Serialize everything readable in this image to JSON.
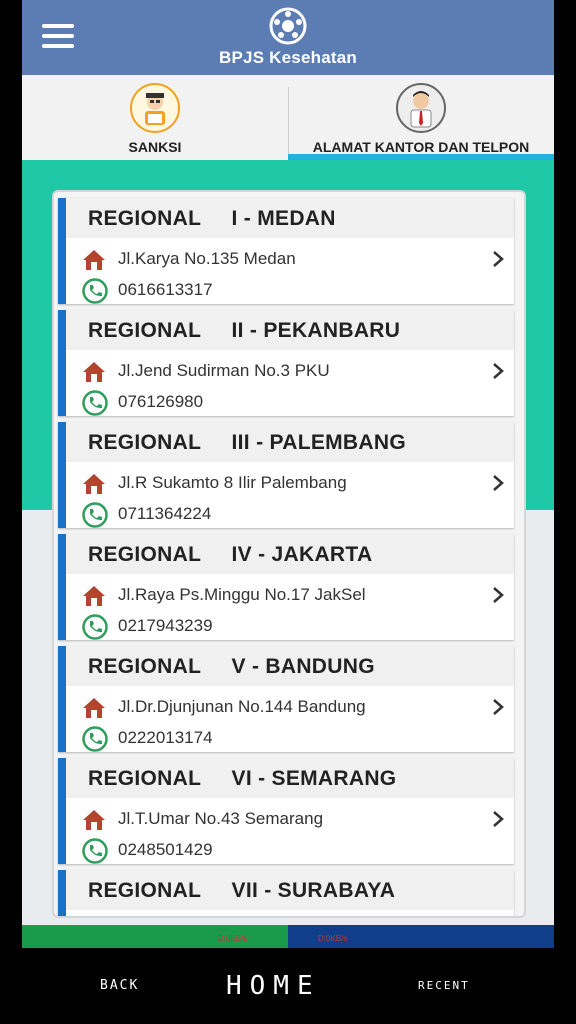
{
  "header": {
    "brand": "BPJS Kesehatan"
  },
  "tabs": [
    {
      "label": "SANKSI"
    },
    {
      "label": "ALAMAT KANTOR DAN TELPON"
    }
  ],
  "status": {
    "speed_left": "D:0KB/s",
    "speed_right": "D:0KB/s"
  },
  "offices": [
    {
      "title": "REGIONAL     I - MEDAN",
      "address": "Jl.Karya No.135 Medan",
      "phone": "0616613317"
    },
    {
      "title": "REGIONAL     II - PEKANBARU",
      "address": "Jl.Jend Sudirman No.3 PKU",
      "phone": "076126980"
    },
    {
      "title": "REGIONAL     III - PALEMBANG",
      "address": "Jl.R Sukamto 8 Ilir Palembang",
      "phone": "0711364224"
    },
    {
      "title": "REGIONAL     IV - JAKARTA",
      "address": "Jl.Raya Ps.Minggu No.17 JakSel",
      "phone": "0217943239"
    },
    {
      "title": "REGIONAL     V - BANDUNG",
      "address": "Jl.Dr.Djunjunan No.144 Bandung",
      "phone": "0222013174"
    },
    {
      "title": "REGIONAL     VI - SEMARANG",
      "address": "Jl.T.Umar No.43 Semarang",
      "phone": "0248501429"
    },
    {
      "title": "REGIONAL     VII - SURABAYA",
      "address": "",
      "phone": ""
    }
  ],
  "navbar": {
    "back": "BACK",
    "home": "HOME",
    "recent": "RECENT"
  },
  "colors": {
    "header": "#5b7db3",
    "accent_bar": "#1a6fc6",
    "tab_underline": "#1fb3d9",
    "teal_bg": "#1fc9a8"
  }
}
